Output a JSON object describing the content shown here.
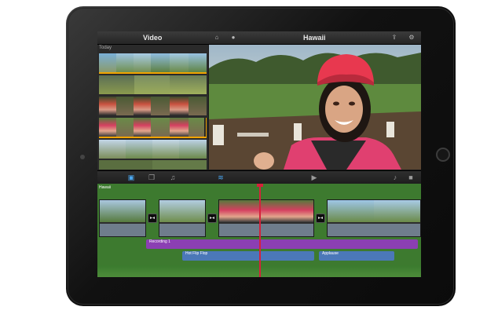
{
  "app": {
    "panel_title": "Video",
    "project_title": "Hawaii",
    "browser_section": "Today"
  },
  "icons": {
    "home": "home-icon",
    "info": "info-icon",
    "share": "share-icon",
    "settings": "gear-icon",
    "video_browser": "film-strip-icon",
    "photos": "photos-icon",
    "audio": "music-note-icon",
    "voiceover": "waveform-icon",
    "play": "play-icon",
    "mic": "microphone-icon",
    "camera": "video-camera-icon"
  },
  "timeline": {
    "project_label": "Hawaii",
    "voiceover_label": "Recording 1",
    "music_label": "Hot Flip Flop",
    "sfx_label": "Applause"
  },
  "colors": {
    "timeline_bg": "#3d7a2f",
    "voiceover_track": "#8b3fb3",
    "music_track": "#4b78b8",
    "playhead": "#d6213b",
    "selection": "#f1a400"
  }
}
